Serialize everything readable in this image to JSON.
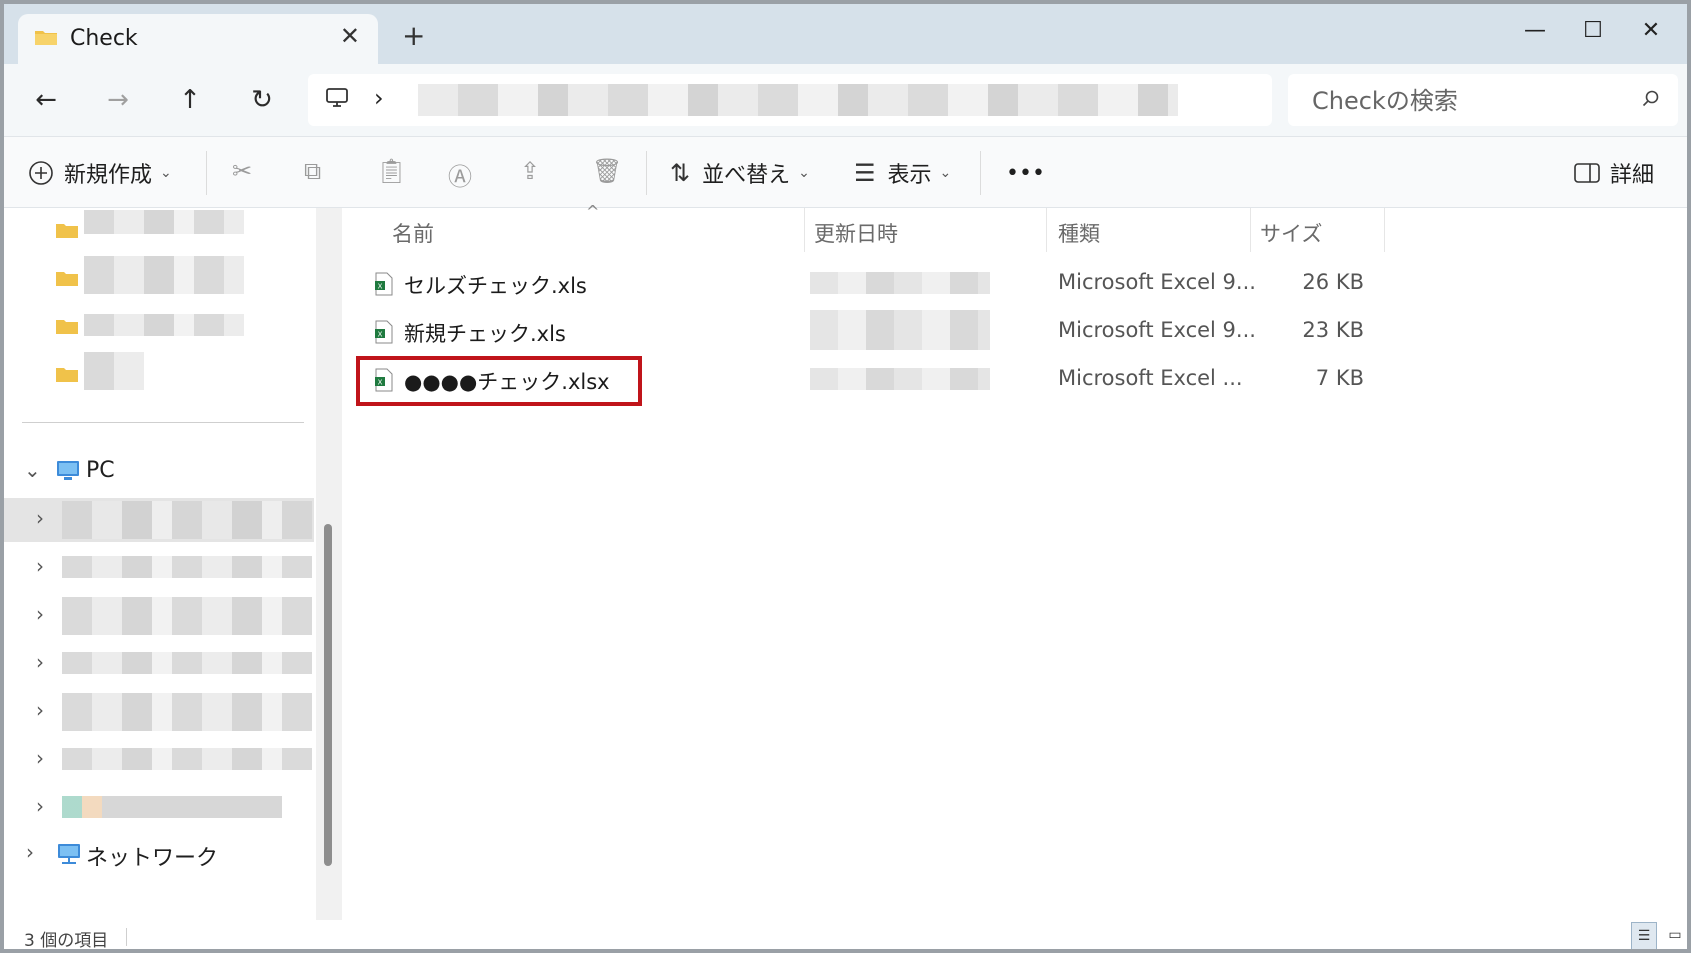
{
  "window": {
    "tab_title": "Check",
    "new_tab": "+",
    "close_tab": "✕",
    "minimize": "—",
    "maximize": "☐",
    "close": "✕"
  },
  "nav": {
    "back": "←",
    "forward": "→",
    "up": "↑",
    "refresh": "↻",
    "address_chevron": "›"
  },
  "search": {
    "placeholder": "Checkの検索"
  },
  "commands": {
    "new": "新規作成",
    "sort": "並べ替え",
    "view": "表示",
    "more": "•••",
    "details": "詳細",
    "caret": "⌄"
  },
  "left_pane": {
    "pc": "PC",
    "network": "ネットワーク",
    "expand": "›",
    "collapse": "⌄"
  },
  "columns": {
    "name": "名前",
    "modified": "更新日時",
    "type": "種類",
    "size": "サイズ",
    "sort_indicator": "^"
  },
  "files": [
    {
      "name": "セルズチェック.xls",
      "type": "Microsoft Excel 9...",
      "size": "26 KB"
    },
    {
      "name": "新規チェック.xls",
      "type": "Microsoft Excel 9...",
      "size": "23 KB"
    },
    {
      "name": "●●●●チェック.xlsx",
      "type": "Microsoft Excel ...",
      "size": "7 KB"
    }
  ],
  "status": {
    "item_count": "3 個の項目"
  },
  "colors": {
    "highlight": "#c0141a",
    "folder": "#f0c24a",
    "excel": "#1f7a3f"
  }
}
